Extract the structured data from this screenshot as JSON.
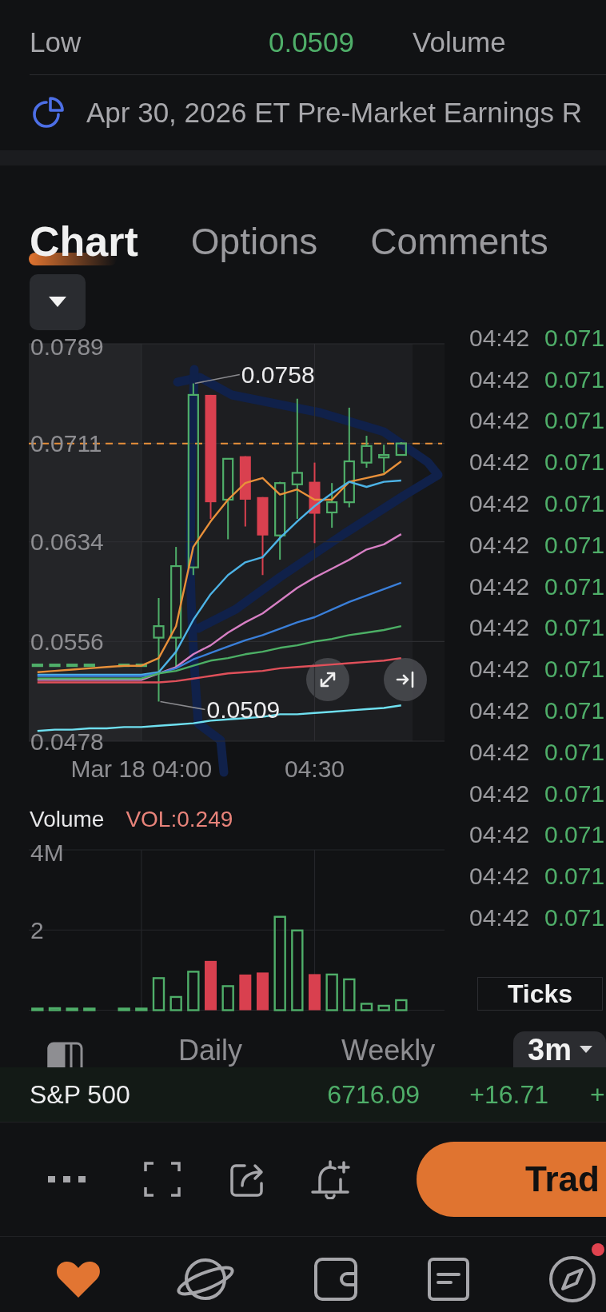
{
  "quote_stats": {
    "rows": [
      {
        "label": "Low",
        "value": "0.0509",
        "label_2": "Volume"
      }
    ]
  },
  "earnings_notice": {
    "text": "Apr 30, 2026 ET Pre-Market Earnings R"
  },
  "tabs": [
    {
      "label": "Chart",
      "selected": true
    },
    {
      "label": "Options",
      "selected": false
    },
    {
      "label": "Comments",
      "selected": false
    }
  ],
  "price_chart": {
    "chart_data": {
      "type": "candlestick",
      "grid": true,
      "categories": [
        null,
        null,
        null,
        null,
        null,
        null,
        "Mar 18 04:00",
        null,
        null,
        null,
        null,
        null,
        null,
        null,
        null,
        null,
        "04:30",
        null,
        null,
        null,
        null,
        null,
        null,
        null
      ],
      "ylim": [
        0.0478,
        0.0789
      ],
      "yticks": [
        0.0478,
        0.0556,
        0.0634,
        0.0711,
        0.0789
      ],
      "ohlc": [
        [
          0.0537,
          0.0538,
          0.0537,
          0.0538
        ],
        [
          0.0537,
          0.0538,
          0.0537,
          0.0538
        ],
        [
          0.0537,
          0.0538,
          0.0537,
          0.0538
        ],
        [
          0.0537,
          0.0538,
          0.0537,
          0.0538
        ],
        null,
        [
          0.0537,
          0.0538,
          0.0537,
          0.0538
        ],
        [
          0.0537,
          0.0538,
          0.0537,
          0.0538
        ],
        [
          0.0559,
          0.059,
          0.0509,
          0.0568
        ],
        [
          0.0559,
          0.063,
          0.0536,
          0.0615
        ],
        [
          0.0614,
          0.0758,
          0.0608,
          0.0749
        ],
        [
          0.0749,
          0.0749,
          0.0652,
          0.0665
        ],
        [
          0.0667,
          0.0699,
          0.0636,
          0.0699
        ],
        [
          0.0701,
          0.0701,
          0.0646,
          0.0667
        ],
        [
          0.0669,
          0.0669,
          0.0608,
          0.0639
        ],
        [
          0.0639,
          0.0681,
          0.062,
          0.068
        ],
        [
          0.0679,
          0.0746,
          0.0652,
          0.0688
        ],
        [
          0.0681,
          0.0696,
          0.0633,
          0.0656
        ],
        [
          0.0657,
          0.068,
          0.0645,
          0.0665
        ],
        [
          0.0665,
          0.0739,
          0.0661,
          0.0697
        ],
        [
          0.0696,
          0.0717,
          0.0692,
          0.0709
        ],
        [
          0.07,
          0.071,
          0.0688,
          0.0702
        ],
        [
          0.0702,
          0.0712,
          0.0702,
          0.0711
        ],
        null,
        null
      ],
      "series": [
        {
          "type": "line",
          "color": "#e8903a",
          "values": [
            0.0532,
            0.0533,
            0.0534,
            0.0535,
            0.0536,
            0.0537,
            0.0537,
            0.0543,
            0.0568,
            0.063,
            0.065,
            0.0667,
            0.068,
            0.0684,
            0.0671,
            0.0675,
            0.0667,
            0.0667,
            0.0681,
            0.0684,
            0.0687,
            0.0697,
            null,
            null
          ]
        },
        {
          "type": "line",
          "color": "#4db3e6",
          "values": [
            0.053,
            0.053,
            0.053,
            0.053,
            0.053,
            0.053,
            0.053,
            0.0532,
            0.0548,
            0.0573,
            0.0593,
            0.0608,
            0.0618,
            0.0622,
            0.0637,
            0.065,
            0.0662,
            0.0672,
            0.0681,
            0.0677,
            0.0681,
            0.0682,
            null,
            null
          ]
        },
        {
          "type": "line",
          "color": "#d77fc4",
          "values": [
            0.0526,
            0.0526,
            0.0526,
            0.0526,
            0.0526,
            0.0526,
            0.0526,
            0.0531,
            0.0536,
            0.0546,
            0.0553,
            0.0563,
            0.0571,
            0.0578,
            0.0588,
            0.0598,
            0.0606,
            0.0613,
            0.062,
            0.0628,
            0.0632,
            0.064,
            null,
            null
          ]
        },
        {
          "type": "line",
          "color": "#3a7fd9",
          "values": [
            0.0529,
            0.0529,
            0.0529,
            0.0529,
            0.0529,
            0.0529,
            0.0529,
            0.0531,
            0.0535,
            0.0542,
            0.0547,
            0.0552,
            0.0557,
            0.0561,
            0.0566,
            0.0571,
            0.0575,
            0.0581,
            0.0587,
            0.0592,
            0.0597,
            0.0602,
            null,
            null
          ]
        },
        {
          "type": "line",
          "color": "#4caf65",
          "values": [
            0.0527,
            0.0527,
            0.0527,
            0.0527,
            0.0527,
            0.0527,
            0.0527,
            0.0531,
            0.0533,
            0.0537,
            0.0541,
            0.0543,
            0.0546,
            0.0548,
            0.0551,
            0.0553,
            0.0556,
            0.0558,
            0.0561,
            0.0563,
            0.0565,
            0.0568,
            null,
            null
          ]
        },
        {
          "type": "line",
          "color": "#e0505a",
          "values": [
            0.0524,
            0.0524,
            0.0524,
            0.0524,
            0.0524,
            0.0524,
            0.0524,
            0.0524,
            0.0525,
            0.0527,
            0.0529,
            0.0531,
            0.0532,
            0.0533,
            0.0535,
            0.0536,
            0.0537,
            0.0538,
            0.0539,
            0.054,
            0.0541,
            0.0543,
            null,
            null
          ]
        },
        {
          "type": "line",
          "color": "#6fe0f0",
          "values": [
            0.0486,
            0.0487,
            0.0487,
            0.0488,
            0.0488,
            0.0489,
            0.0489,
            0.049,
            0.0491,
            0.0492,
            0.0494,
            0.0495,
            0.0496,
            0.0497,
            0.0499,
            0.0499,
            0.05,
            0.0501,
            0.0502,
            0.0503,
            0.0504,
            0.0506,
            null,
            null
          ]
        }
      ],
      "ref_lines": [
        {
          "axis": "y",
          "value": 0.0711
        }
      ],
      "annotations": [
        "0.0758",
        "0.0509"
      ]
    }
  },
  "volume_chart": {
    "title": "Volume",
    "reading": "VOL:0.249",
    "chart_data": {
      "type": "bar",
      "grid": true,
      "categories": [
        null,
        null,
        null,
        null,
        null,
        null,
        null,
        null,
        null,
        null,
        null,
        null,
        null,
        null,
        null,
        null,
        null,
        null,
        null,
        null,
        null,
        null,
        null,
        null
      ],
      "ylim": [
        0,
        4
      ],
      "yticks": [
        {
          "value": 2,
          "label": "2"
        },
        {
          "value": 4,
          "label": "4M"
        }
      ],
      "series": [
        {
          "color": "#4fae69",
          "values": [
            0.02,
            0.05,
            0.02,
            0.02,
            null,
            0.04,
            0.02,
            0.8,
            0.33,
            0.96,
            null,
            0.6,
            null,
            null,
            2.33,
            1.99,
            null,
            0.89,
            0.77,
            0.16,
            0.11,
            0.25,
            null,
            null
          ]
        },
        {
          "color": "#d9404f",
          "values": [
            null,
            null,
            null,
            null,
            null,
            null,
            null,
            null,
            null,
            null,
            1.23,
            null,
            0.89,
            0.94,
            null,
            null,
            0.9,
            null,
            null,
            null,
            null,
            null,
            null,
            null
          ]
        }
      ]
    }
  },
  "ticks": {
    "rows": [
      {
        "time": "04:42",
        "price": "0.071"
      },
      {
        "time": "04:42",
        "price": "0.071"
      },
      {
        "time": "04:42",
        "price": "0.071"
      },
      {
        "time": "04:42",
        "price": "0.071"
      },
      {
        "time": "04:42",
        "price": "0.071"
      },
      {
        "time": "04:42",
        "price": "0.071"
      },
      {
        "time": "04:42",
        "price": "0.071"
      },
      {
        "time": "04:42",
        "price": "0.071"
      },
      {
        "time": "04:42",
        "price": "0.071"
      },
      {
        "time": "04:42",
        "price": "0.071"
      },
      {
        "time": "04:42",
        "price": "0.071"
      },
      {
        "time": "04:42",
        "price": "0.071"
      },
      {
        "time": "04:42",
        "price": "0.071"
      },
      {
        "time": "04:42",
        "price": "0.071"
      },
      {
        "time": "04:42",
        "price": "0.071"
      }
    ],
    "button": "Ticks"
  },
  "period_bar": {
    "items": [
      {
        "kind": "tab",
        "label": "Daily",
        "selected": false
      },
      {
        "kind": "tab",
        "label": "Weekly",
        "selected": false
      },
      {
        "kind": "dropdown",
        "label": "3m",
        "selected": true
      }
    ]
  },
  "index_ticker": {
    "name": "S&P 500",
    "price": "6716.09",
    "change": "+16.71",
    "change_percent": "+"
  },
  "action_bar": {
    "trade_button": "Trad"
  },
  "nav": {
    "items": [
      {
        "selected": true,
        "badge": false
      },
      {
        "selected": false,
        "badge": false
      },
      {
        "selected": false,
        "badge": false
      },
      {
        "selected": false,
        "badge": false
      },
      {
        "selected": false,
        "badge": true
      }
    ]
  }
}
